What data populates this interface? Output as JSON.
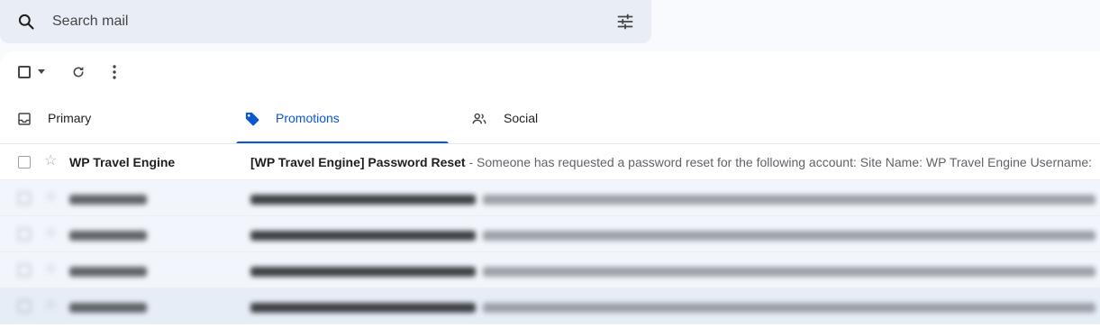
{
  "search": {
    "placeholder": "Search mail",
    "icon": "search-icon",
    "options_icon": "filter-icon"
  },
  "toolbar": {
    "select_icon": "checkbox-icon",
    "select_menu_icon": "caret-down-icon",
    "refresh_icon": "refresh-icon",
    "more_icon": "more-vert-icon"
  },
  "tabs": [
    {
      "label": "Primary",
      "icon": "inbox-icon",
      "active": false
    },
    {
      "label": "Promotions",
      "icon": "tag-icon",
      "active": true
    },
    {
      "label": "Social",
      "icon": "people-icon",
      "active": false
    }
  ],
  "colors": {
    "accent": "#0b57d0",
    "search_bg": "#e9eef6",
    "page_bg": "#f8fafd"
  },
  "emails": [
    {
      "sender": "WP Travel Engine",
      "subject": "[WP Travel Engine] Password Reset",
      "snippet": " - Someone has requested a password reset for the following account: Site Name: WP Travel Engine Username:",
      "unread": true
    },
    {
      "sender": "",
      "subject": "",
      "snippet": "",
      "obscured": true
    },
    {
      "sender": "",
      "subject": "",
      "snippet": "",
      "obscured": true
    },
    {
      "sender": "",
      "subject": "",
      "snippet": "",
      "obscured": true
    },
    {
      "sender": "",
      "subject": "",
      "snippet": "",
      "obscured": true
    }
  ]
}
